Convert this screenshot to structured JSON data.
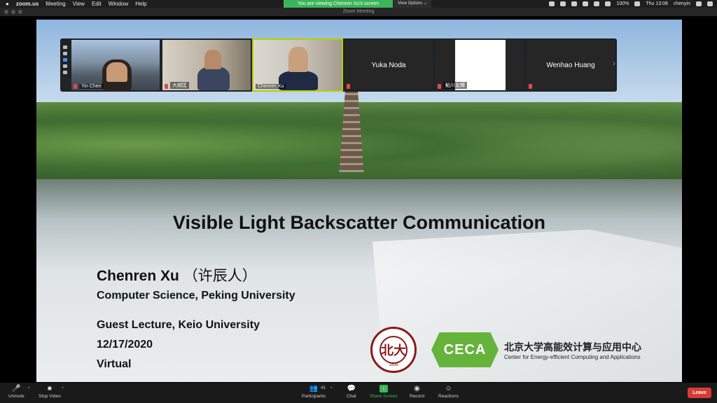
{
  "menubar": {
    "app": "zoom.us",
    "menus": [
      "Meeting",
      "View",
      "Edit",
      "Window",
      "Help"
    ],
    "banner": "You are viewing Chenren Xu's screen",
    "view_options": "View Options ⌄",
    "battery": "100%",
    "clock": "Thu 13:08",
    "user": "chenyin"
  },
  "window": {
    "title": "Zoom Meeting"
  },
  "gallery": {
    "tiles": [
      {
        "name": "Yin Chen",
        "type": "video"
      },
      {
        "name": "大越匡",
        "type": "video"
      },
      {
        "name": "Chenren Xu",
        "type": "video",
        "active": true
      },
      {
        "name": "Yuka Noda",
        "type": "name"
      },
      {
        "name": "鮎川友輝",
        "type": "blank"
      },
      {
        "name": "Wenhao Huang",
        "type": "name"
      }
    ]
  },
  "slide": {
    "title": "Visible Light Backscatter Communication",
    "presenter": "Chenren Xu",
    "presenter_cn": "（许辰人）",
    "affiliation": "Computer Science, Peking University",
    "event": "Guest Lecture, Keio University",
    "date": "12/17/2020",
    "mode": "Virtual",
    "pku_logo_char": "北大",
    "pku_logo_year": "1898",
    "ceca_logo": "CECA",
    "ceca_cn": "北京大学高能效计算与应用中心",
    "ceca_en": "Center for Energy-efficient Computing and Applications"
  },
  "toolbar": {
    "unmute": "Unmute",
    "stop_video": "Stop Video",
    "participants": "Participants",
    "participant_count": "43",
    "chat": "Chat",
    "share_screen": "Share Screen",
    "record": "Record",
    "reactions": "Reactions",
    "leave": "Leave"
  },
  "colors": {
    "accent_green": "#3cb55a",
    "leave_red": "#d83a34",
    "active_speaker": "#b4d000"
  }
}
